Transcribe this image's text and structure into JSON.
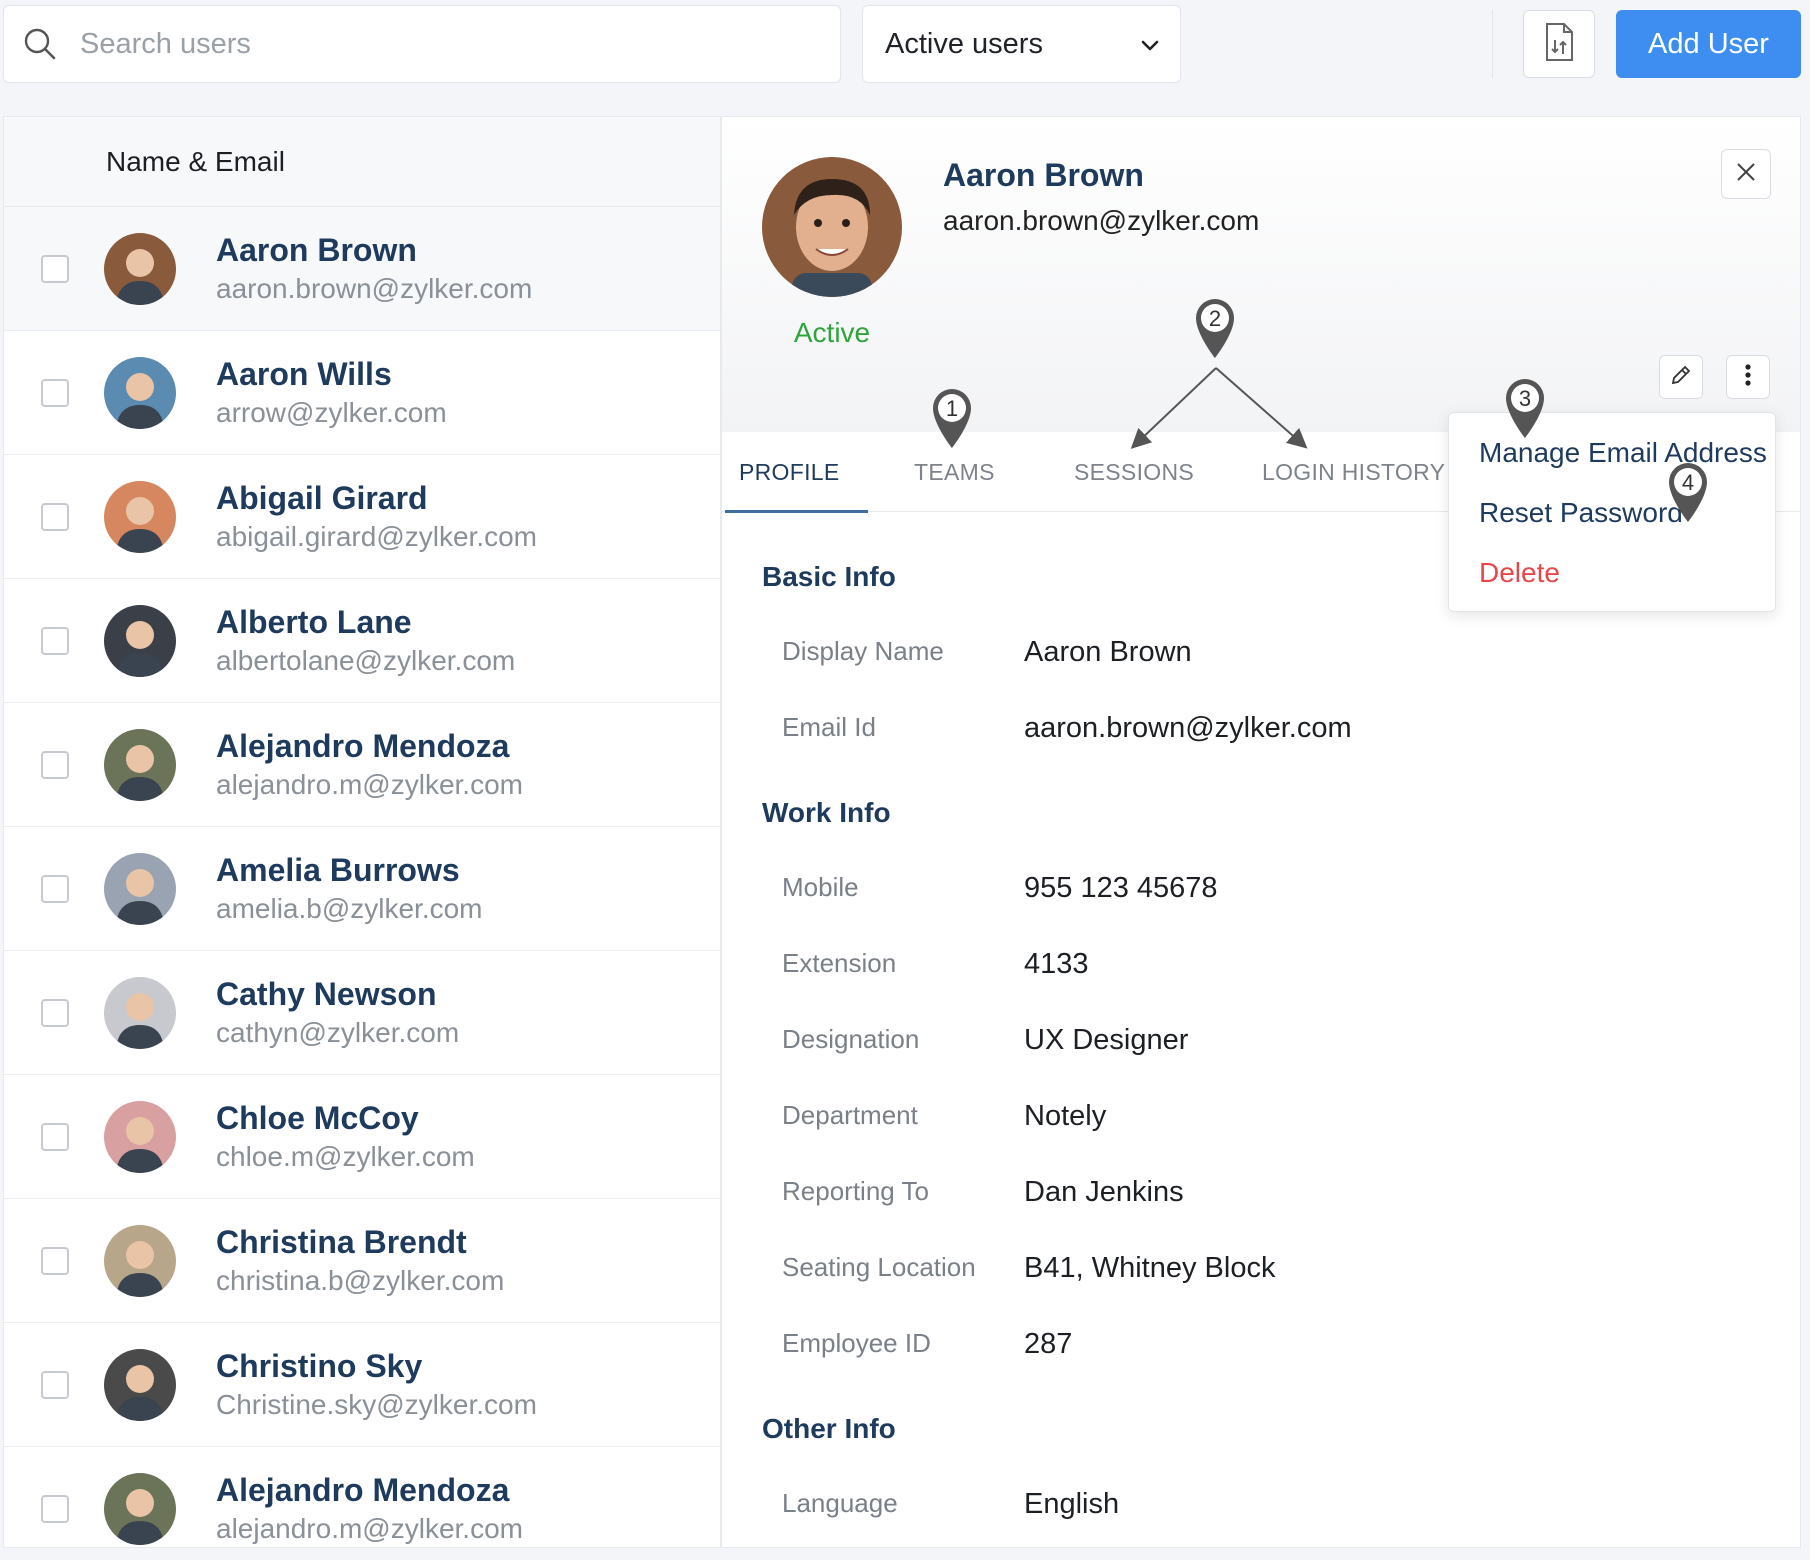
{
  "toolbar": {
    "search_placeholder": "Search users",
    "filter_value": "Active users",
    "add_label": "Add User"
  },
  "list": {
    "header": "Name & Email",
    "users": [
      {
        "name": "Aaron Brown",
        "email": "aaron.brown@zylker.com",
        "avatar_color": "#8a5a3c"
      },
      {
        "name": "Aaron Wills",
        "email": "arrow@zylker.com",
        "avatar_color": "#5b8bb0"
      },
      {
        "name": "Abigail Girard",
        "email": "abigail.girard@zylker.com",
        "avatar_color": "#d7875f"
      },
      {
        "name": "Alberto Lane",
        "email": "albertolane@zylker.com",
        "avatar_color": "#3b3f48"
      },
      {
        "name": "Alejandro Mendoza",
        "email": "alejandro.m@zylker.com",
        "avatar_color": "#6b7458"
      },
      {
        "name": "Amelia Burrows",
        "email": "amelia.b@zylker.com",
        "avatar_color": "#9aa3b2"
      },
      {
        "name": "Cathy Newson",
        "email": "cathyn@zylker.com",
        "avatar_color": "#c7c9cf"
      },
      {
        "name": "Chloe McCoy",
        "email": "chloe.m@zylker.com",
        "avatar_color": "#d8a0a0"
      },
      {
        "name": "Christina Brendt",
        "email": "christina.b@zylker.com",
        "avatar_color": "#b8a68a"
      },
      {
        "name": "Christino Sky",
        "email": "Christine.sky@zylker.com",
        "avatar_color": "#4a4a4a"
      },
      {
        "name": "Alejandro Mendoza",
        "email": "alejandro.m@zylker.com",
        "avatar_color": "#6b7458"
      }
    ]
  },
  "detail": {
    "name": "Aaron Brown",
    "email": "aaron.brown@zylker.com",
    "status": "Active",
    "tabs": [
      "PROFILE",
      "TEAMS",
      "SESSIONS",
      "LOGIN HISTORY"
    ],
    "basic_info": {
      "title": "Basic Info",
      "fields": [
        {
          "label": "Display Name",
          "value": "Aaron Brown"
        },
        {
          "label": "Email Id",
          "value": "aaron.brown@zylker.com"
        }
      ]
    },
    "work_info": {
      "title": "Work Info",
      "fields": [
        {
          "label": "Mobile",
          "value": "955 123 45678"
        },
        {
          "label": "Extension",
          "value": "4133"
        },
        {
          "label": "Designation",
          "value": "UX Designer"
        },
        {
          "label": "Department",
          "value": "Notely"
        },
        {
          "label": "Reporting To",
          "value": "Dan Jenkins"
        },
        {
          "label": "Seating Location",
          "value": "B41, Whitney Block"
        },
        {
          "label": "Employee ID",
          "value": "287"
        }
      ]
    },
    "other_info": {
      "title": "Other Info",
      "fields": [
        {
          "label": "Language",
          "value": "English"
        }
      ]
    }
  },
  "menu": {
    "items": [
      "Manage Email Address",
      "Reset Password",
      "Delete"
    ]
  },
  "annotations": [
    "1",
    "2",
    "3",
    "4"
  ],
  "colors": {
    "accent": "#3d8ef0",
    "name_text": "#1e3a5c",
    "active_status": "#2fa43a",
    "danger": "#e8474a"
  }
}
